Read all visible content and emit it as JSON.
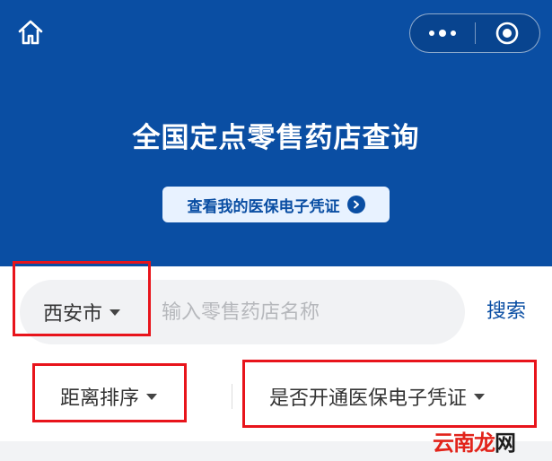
{
  "header": {
    "title": "全国定点零售药店查询",
    "credential_button": "查看我的医保电子凭证"
  },
  "search": {
    "city": "西安市",
    "placeholder": "输入零售药店名称",
    "value": "",
    "submit_label": "搜索"
  },
  "filters": {
    "sort_label": "距离排序",
    "credential_filter_label": "是否开通医保电子凭证"
  },
  "watermark": {
    "part1": "云南",
    "part2": "龙",
    "part3": "网"
  },
  "colors": {
    "header_bg": "#0a4ea3",
    "accent": "#0a4ea3",
    "highlight_box": "#e8141b"
  }
}
